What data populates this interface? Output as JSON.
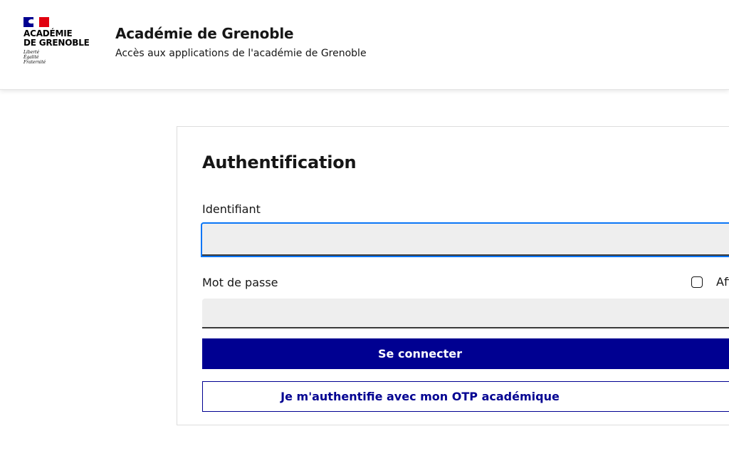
{
  "header": {
    "logo": {
      "name": "ACADÉMIE\nDE GRENOBLE",
      "motto": "Liberté\nÉgalité\nFraternité"
    },
    "title": "Académie de Grenoble",
    "subtitle": "Accès aux applications de l'académie de Grenoble"
  },
  "form": {
    "title": "Authentification",
    "username_label": "Identifiant",
    "username_value": "",
    "password_label": "Mot de passe",
    "password_value": "",
    "show_password_label": "Afficher",
    "show_password_checked": false,
    "login_button": "Se connecter",
    "otp_button": "Je m'authentifie avec mon OTP académique"
  },
  "colors": {
    "primary": "#000091",
    "flag_red": "#e1000f",
    "focus_border": "#0a76f6",
    "input_bg": "#eeeeee"
  }
}
